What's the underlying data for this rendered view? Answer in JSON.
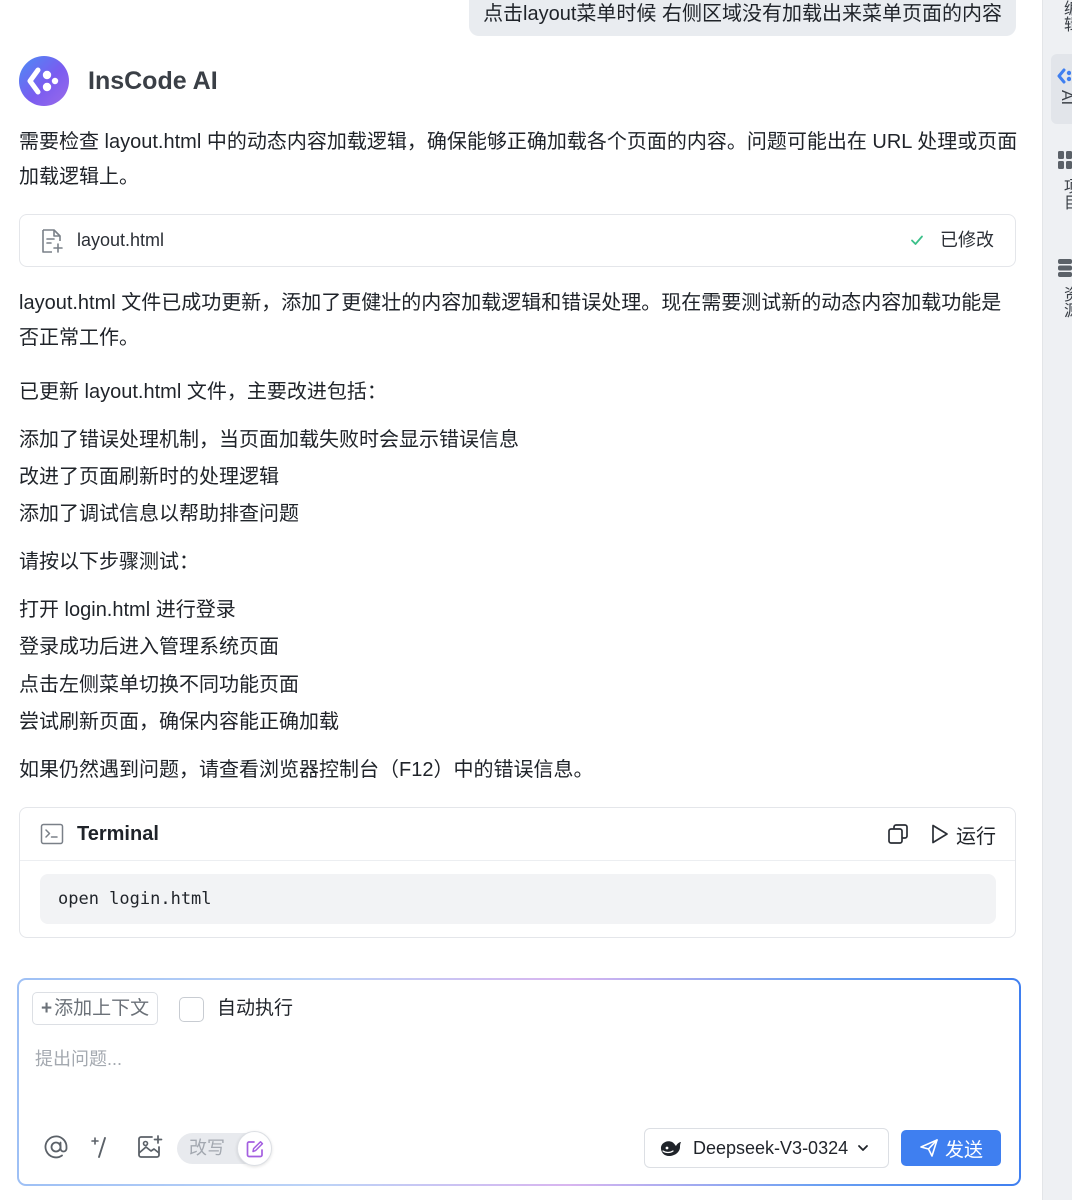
{
  "user_message": "点击layout菜单时候 右侧区域没有加载出来菜单页面的内容",
  "assistant": {
    "name": "InsCode AI",
    "intro": "需要检查 layout.html 中的动态内容加载逻辑，确保能够正确加载各个页面的内容。问题可能出在 URL 处理或页面加载逻辑上。",
    "file_card": {
      "filename": "layout.html",
      "status": "已修改",
      "icon": "file-edit-icon"
    },
    "update_note": "layout.html 文件已成功更新，添加了更健壮的内容加载逻辑和错误处理。现在需要测试新的动态内容加载功能是否正常工作。",
    "improvements_heading": "已更新 layout.html 文件，主要改进包括：",
    "improvements": [
      "添加了错误处理机制，当页面加载失败时会显示错误信息",
      "改进了页面刷新时的处理逻辑",
      "添加了调试信息以帮助排查问题"
    ],
    "steps_heading": "请按以下步骤测试：",
    "steps": [
      "打开 login.html 进行登录",
      "登录成功后进入管理系统页面",
      "点击左侧菜单切换不同功能页面",
      "尝试刷新页面，确保内容能正确加载"
    ],
    "closing": "如果仍然遇到问题，请查看浏览器控制台（F12）中的错误信息。",
    "terminal": {
      "title": "Terminal",
      "run_label": "运行",
      "command": "open login.html"
    }
  },
  "composer": {
    "add_context_label": "添加上下文",
    "auto_execute_label": "自动执行",
    "auto_execute_checked": false,
    "placeholder": "提出问题...",
    "rewrite_label": "改写",
    "model": "Deepseek-V3-0324",
    "send_label": "发送",
    "accent_color": "#3f7ff0"
  },
  "right_rail": {
    "items": [
      {
        "label": "编辑"
      },
      {
        "label": "AI",
        "active": true
      },
      {
        "label": "项目"
      },
      {
        "label": "资源"
      }
    ]
  }
}
